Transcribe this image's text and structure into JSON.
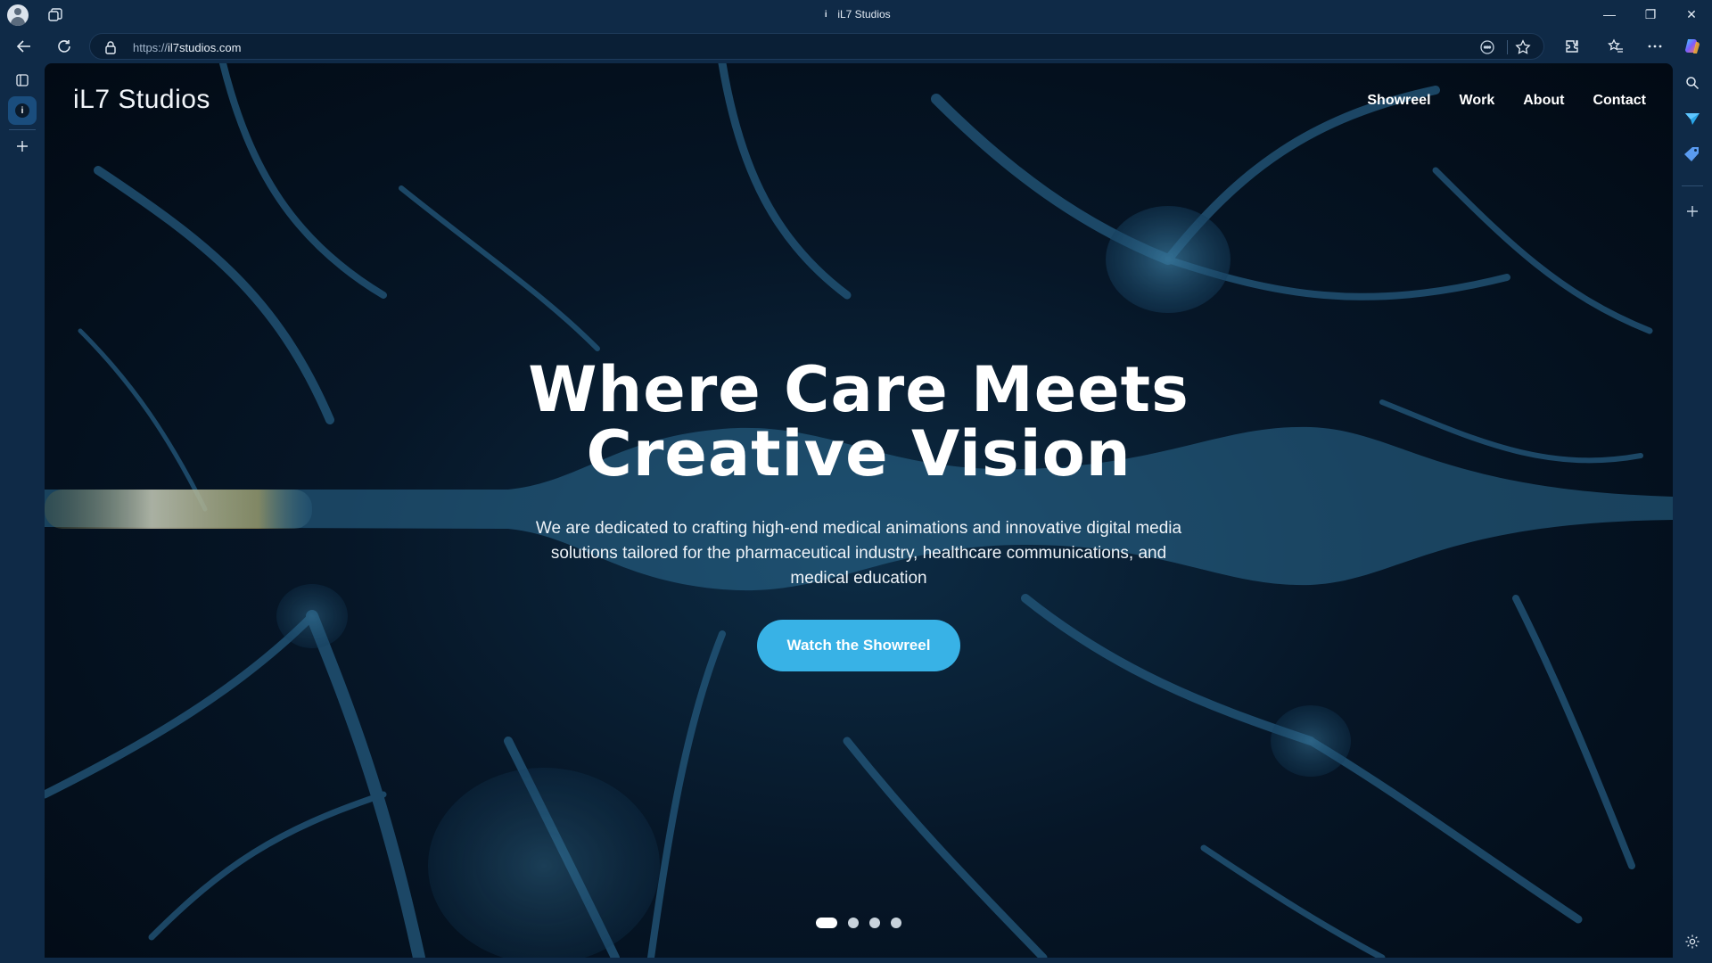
{
  "browser": {
    "window_title": "iL7 Studios",
    "favicon_letter": "i",
    "url_prefix": "https://",
    "url_host": "il7studios.com",
    "controls": {
      "minimize": "—",
      "restore": "❐",
      "close": "✕"
    }
  },
  "site": {
    "logo": "iL7 Studios",
    "nav": [
      "Showreel",
      "Work",
      "About",
      "Contact"
    ]
  },
  "hero": {
    "headline": "Where Care Meets Creative Vision",
    "description": "We are dedicated to crafting high-end medical animations and innovative digital media solutions tailored for the pharmaceutical industry, healthcare communications, and medical education",
    "cta": "Watch the Showreel"
  },
  "carousel": {
    "slides": 4,
    "active_index": 0
  },
  "colors": {
    "chrome": "#0f2a47",
    "accent": "#38b2e6",
    "hero_background": "#061627"
  },
  "icons": {
    "browser": [
      "profile-icon",
      "workspaces-icon",
      "back-icon",
      "refresh-icon",
      "lock-icon",
      "ai-icon",
      "favorite-icon",
      "extensions-icon",
      "favorites-bar-icon",
      "more-icon",
      "copilot-icon"
    ],
    "sidebar": [
      "search-icon",
      "send-icon",
      "tag-icon",
      "add-icon",
      "settings-icon"
    ]
  }
}
